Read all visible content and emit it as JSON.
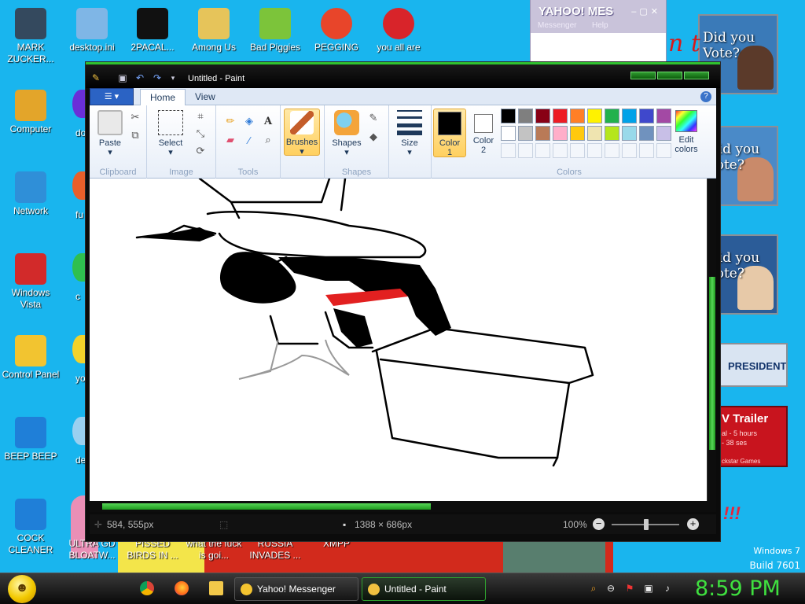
{
  "desktop": {
    "icons_col1": [
      {
        "label": "MARK ZUCKER...",
        "icon": "user-icon",
        "color": "#34495e"
      },
      {
        "label": "Computer",
        "icon": "computer-icon",
        "color": "#e3a52a"
      },
      {
        "label": "Network",
        "icon": "network-icon",
        "color": "#2f8fd8"
      },
      {
        "label": "Windows Vista",
        "icon": "recycle-bin-icon",
        "color": "#d22a2a"
      },
      {
        "label": "Control Panel",
        "icon": "control-panel-icon",
        "color": "#f2c430"
      },
      {
        "label": "BEEP BEEP",
        "icon": "file-icon",
        "color": "#1f7fd8"
      },
      {
        "label": "COCK CLEANER",
        "icon": "file-icon",
        "color": "#1f7fd8"
      }
    ],
    "icons_row1": [
      {
        "label": "desktop.ini",
        "icon": "settings-file-icon",
        "color": "#7fb6e6"
      },
      {
        "label": "2PACAL...",
        "icon": "terminal-icon",
        "color": "#111111"
      },
      {
        "label": "Among Us",
        "icon": "folder-icon",
        "color": "#e6c45a"
      },
      {
        "label": "Bad Piggies",
        "icon": "pig-icon",
        "color": "#7cc43a"
      },
      {
        "label": "PEGGING",
        "icon": "p-logo-icon",
        "color": "#e8452a"
      },
      {
        "label": "you all are",
        "icon": "dev-cpp-icon",
        "color": "#d8242a"
      }
    ],
    "partial_icons": [
      {
        "label": "doe",
        "color": "#6a2fd8"
      },
      {
        "label": "fu",
        "color": "#e85f2a"
      },
      {
        "label": "c",
        "color": "#2fbf4f"
      },
      {
        "label": "yo",
        "color": "#f2d22a"
      },
      {
        "label": "des",
        "color": "#9ad0f0"
      }
    ],
    "bottom_labels": [
      {
        "label": "ULTRA GD BLOATW..."
      },
      {
        "label": "PISSED BIRDS IN ..."
      },
      {
        "label": "what the fuck is goi..."
      },
      {
        "label": "RUSSIA INVADES ..."
      },
      {
        "label": "XMPP"
      }
    ],
    "ads": [
      {
        "text": "Did you Vote?"
      },
      {
        "text": "Did you Vote?"
      },
      {
        "text": "Did you Vote?"
      },
      {
        "text": "PRESIDENT"
      },
      {
        "text": "V Trailer",
        "sub": "al - 5 hours",
        "sub2": "- 38 ses",
        "foot": "ckstar Games"
      }
    ],
    "watermark": {
      "line1": "Windows 7",
      "line2": "Build 7601"
    },
    "partial_red_text": "n t"
  },
  "yahoo_window": {
    "title": "YAHOO! MES",
    "menu": [
      "Messenger",
      "Help"
    ]
  },
  "paint": {
    "title": "Untitled - Paint",
    "tabs": [
      "Home",
      "View"
    ],
    "help": "?",
    "groups": {
      "clipboard": {
        "label": "Clipboard",
        "paste": "Paste"
      },
      "image": {
        "label": "Image",
        "select": "Select"
      },
      "tools": {
        "label": "Tools"
      },
      "brushes": {
        "label": "Brushes"
      },
      "shapes": {
        "label": "Shapes",
        "shapes_btn": "Shapes"
      },
      "size": {
        "label": "Size"
      },
      "colors": {
        "label": "Colors",
        "color1": "Color 1",
        "color2": "Color 2",
        "edit": "Edit colors"
      }
    },
    "palette_row1": [
      "#000000",
      "#7f7f7f",
      "#880015",
      "#ed1c24",
      "#ff7f27",
      "#fff200",
      "#22b14c",
      "#00a2e8",
      "#3f48cc",
      "#a349a4"
    ],
    "palette_row2": [
      "#ffffff",
      "#c3c3c3",
      "#b97a57",
      "#ffaec9",
      "#ffc90e",
      "#efe4b0",
      "#b5e61d",
      "#99d9ea",
      "#7092be",
      "#c8bfe7"
    ],
    "color1_value": "#000000",
    "color2_value": "#ffffff",
    "status": {
      "cursor": "584, 555px",
      "size": "1388 × 686px",
      "zoom": "100%"
    }
  },
  "taskbar": {
    "buttons": [
      {
        "label": "Yahoo! Messenger"
      },
      {
        "label": "Untitled - Paint"
      }
    ],
    "clock": "8:59 PM"
  }
}
